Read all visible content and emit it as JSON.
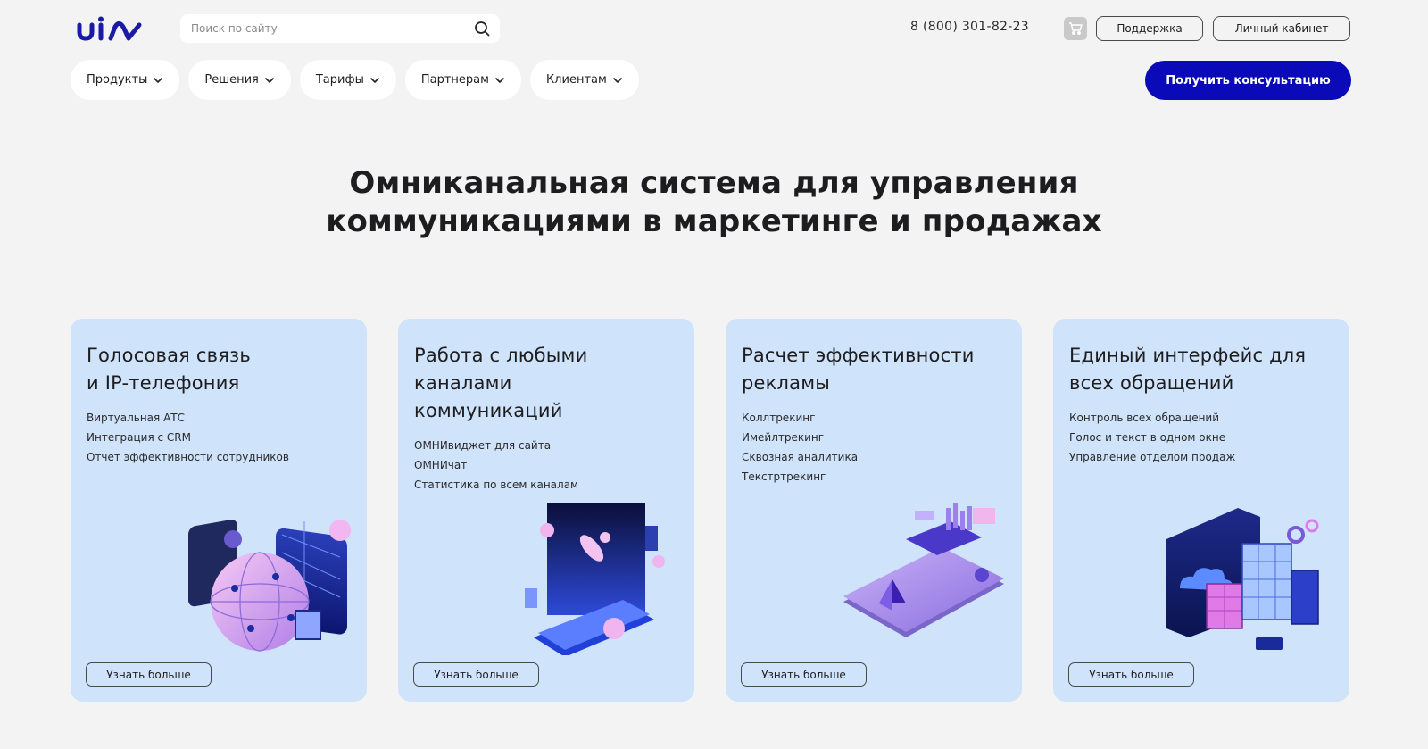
{
  "header": {
    "search_placeholder": "Поиск по сайту",
    "phone": "8 (800) 301-82-23",
    "support_label": "Поддержка",
    "account_label": "Личный кабинет"
  },
  "nav": {
    "items": [
      {
        "label": "Продукты"
      },
      {
        "label": "Решения"
      },
      {
        "label": "Тарифы"
      },
      {
        "label": "Партнерам"
      },
      {
        "label": "Клиентам"
      }
    ],
    "cta_label": "Получить консультацию"
  },
  "hero": {
    "line1": "Омниканальная система для управления",
    "line2": "коммуникациями в маркетинге и продажах"
  },
  "cards": [
    {
      "title_lines": [
        "Голосовая связь",
        "и IP-телефония"
      ],
      "items": [
        "Виртуальная АТС",
        "Интеграция с CRM",
        "Отчет эффективности сотрудников"
      ],
      "button": "Узнать больше",
      "illustration": "globe-server-illustration"
    },
    {
      "title_lines": [
        "Работа с любыми",
        "каналами",
        "коммуникаций"
      ],
      "items": [
        "ОМНИвиджет для сайта",
        "ОМНИчат",
        "Статистика по всем каналам"
      ],
      "button": "Узнать больше",
      "illustration": "phone-floating-person-illustration"
    },
    {
      "title_lines": [
        "Расчет эффективности",
        "рекламы"
      ],
      "items": [
        "Коллтрекинг",
        "Имейлтрекинг",
        "Сквозная аналитика",
        "Текстртрекинг"
      ],
      "button": "Узнать больше",
      "illustration": "analytics-phone-illustration"
    },
    {
      "title_lines": [
        "Единый интерфейс для",
        "всех обращений"
      ],
      "items": [
        "Контроль всех обращений",
        "Голос и текст в одном окне",
        "Управление отделом продаж"
      ],
      "button": "Узнать больше",
      "illustration": "buildings-cloud-illustration"
    }
  ],
  "colors": {
    "background": "#f3f3f3",
    "card": "#cfe3fb",
    "brand": "#0a0ab8",
    "logo": "#1a1aa6"
  }
}
